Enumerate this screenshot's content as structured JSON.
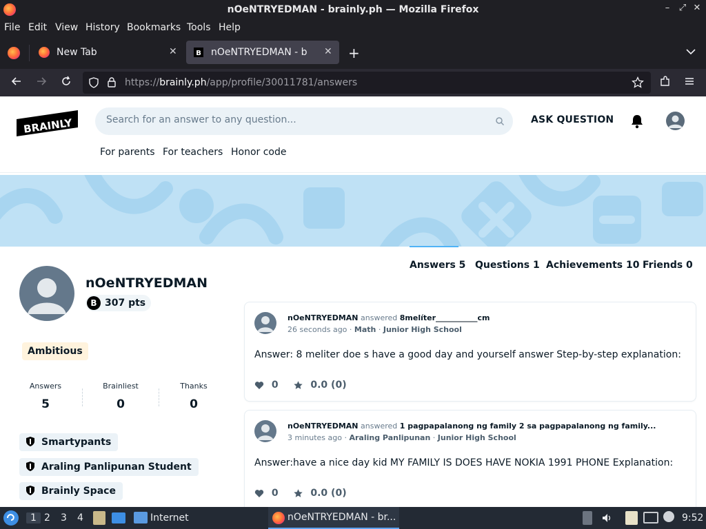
{
  "window": {
    "title": "nOeNTRYEDMAN - brainly.ph — Mozilla Firefox",
    "controls": [
      "–",
      "⤢",
      "✕"
    ]
  },
  "menu": [
    "File",
    "Edit",
    "View",
    "History",
    "Bookmarks",
    "Tools",
    "Help"
  ],
  "tabs": [
    {
      "label": "New Tab"
    },
    {
      "label": "nOeNTRYEDMAN - brainly.ph"
    }
  ],
  "url": {
    "prefix": "https://",
    "host": "brainly.ph",
    "path": "/app/profile/30011781/answers"
  },
  "site": {
    "logo_text": "BRAINLY",
    "search_placeholder": "Search for an answer to any question...",
    "ask_button": "ASK QUESTION",
    "subnav": [
      "For parents",
      "For teachers",
      "Honor code"
    ]
  },
  "profile": {
    "name": "nOeNTRYEDMAN",
    "points": "307 pts",
    "points_icon": "B",
    "rank": "Ambitious",
    "stats": [
      {
        "label": "Answers",
        "value": "5"
      },
      {
        "label": "Brainliest",
        "value": "0"
      },
      {
        "label": "Thanks",
        "value": "0"
      }
    ],
    "badges": [
      "Smartypants",
      "Araling Panlipunan Student",
      "Brainly Space"
    ]
  },
  "profile_tabs": [
    "Answers 5",
    "Questions 1",
    "Achievements 10",
    "Friends 0"
  ],
  "answers": [
    {
      "user": "nOeNTRYEDMAN",
      "verb": "answered",
      "question": "8melíter___________cm",
      "time": "26 seconds ago",
      "subject": "Math",
      "level": "Junior High School",
      "text": "Answer: 8 meliter doe s have a good day and yourself answer Step-by-step explanation:",
      "likes": "0",
      "rating": "0.0 (0)"
    },
    {
      "user": "nOeNTRYEDMAN",
      "verb": "answered",
      "question": "1 pagpapalanong ng family 2 sa pagpapalanong ng family...",
      "time": "3 minutes ago",
      "subject": "Araling Panlipunan",
      "level": "Junior High School",
      "text": "Answer:have a nice day kid MY FAMILY IS DOES HAVE NOKIA 1991 PHONE Explanation:",
      "likes": "0",
      "rating": "0.0 (0)"
    }
  ],
  "taskbar": {
    "workspaces": [
      "1",
      "2",
      "3",
      "4"
    ],
    "launcher_label": "Internet",
    "task_label": "nOeNTRYEDMAN - br...",
    "clock": "9:52"
  },
  "colors": {
    "accent": "#4fb3f6",
    "banner": "#bfe1f5",
    "chrome": "#1f1f24"
  }
}
